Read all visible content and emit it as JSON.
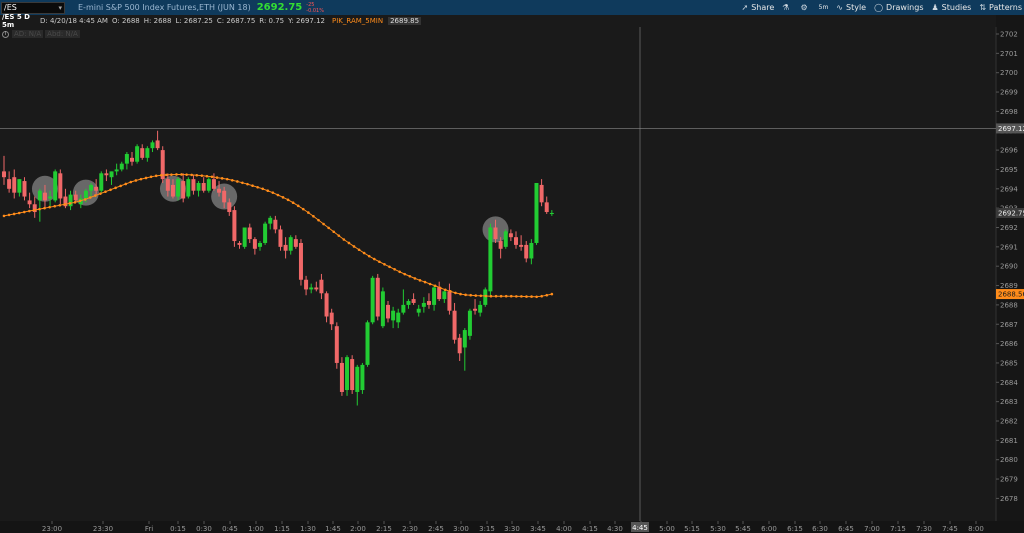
{
  "header": {
    "symbol": "/ES",
    "instrument": "E-mini S&P 500 Index Futures,ETH (JUN 18)",
    "last": "2692.75",
    "change": "-25",
    "change_pct": "-0.01%"
  },
  "toolbar": {
    "share": "Share",
    "style": "Style",
    "drawings": "Drawings",
    "studies": "Studies",
    "patterns": "Patterns",
    "timeframe": "5m"
  },
  "infobar": {
    "symbol": "/ES 5 D 5m",
    "date": "D: 4/20/18 4:45 AM",
    "open": "O: 2688",
    "high": "H: 2688",
    "low": "L: 2687.25",
    "close": "C: 2687.75",
    "range": "R: 0.75",
    "y": "Y: 2697.12",
    "study_name": "PIK_RAM_5MIN",
    "study_value": "2689.85"
  },
  "volume_label": {
    "ad": "AD: N/A",
    "abd": "Abd: N/A"
  },
  "colors": {
    "background": "#1a1a1a",
    "up": "#22cc33",
    "down": "#f06868",
    "ma": "#ff8c1a",
    "crosshair": "#888888",
    "highlight": "#aaaaaa"
  },
  "chart_data": {
    "type": "candlestick",
    "title": "",
    "x_labels": [
      "23:00",
      "23:30",
      "Fri",
      "0:15",
      "0:30",
      "0:45",
      "1:00",
      "1:15",
      "1:30",
      "1:45",
      "2:00",
      "2:15",
      "2:30",
      "2:45",
      "3:00",
      "3:15",
      "3:30",
      "3:45",
      "4:00",
      "4:15",
      "4:30",
      "4:45",
      "5:00",
      "5:15",
      "5:30",
      "5:45",
      "6:00",
      "6:15",
      "6:30",
      "6:45",
      "7:00",
      "7:15",
      "7:30",
      "7:45",
      "8:00"
    ],
    "y_ticks": [
      2678,
      2679,
      2680,
      2681,
      2682,
      2683,
      2684,
      2685,
      2686,
      2687,
      2688,
      2689,
      2690,
      2691,
      2692,
      2693,
      2694,
      2695,
      2696,
      2697,
      2698,
      2699,
      2700,
      2701,
      2702
    ],
    "ylim": [
      2677.8,
      2702.6
    ],
    "last_price_label": "2692.75",
    "ma_last_label": "2688.56",
    "crosshair_price_label": "2697.12",
    "crosshair_time_label": "4:45",
    "candles": [
      {
        "o": 2694.9,
        "h": 2695.7,
        "l": 2694.2,
        "c": 2694.6
      },
      {
        "o": 2694.5,
        "h": 2694.9,
        "l": 2693.8,
        "c": 2694.0
      },
      {
        "o": 2694.6,
        "h": 2695.0,
        "l": 2693.5,
        "c": 2693.8
      },
      {
        "o": 2693.8,
        "h": 2694.5,
        "l": 2693.6,
        "c": 2694.5
      },
      {
        "o": 2694.4,
        "h": 2694.6,
        "l": 2693.4,
        "c": 2693.6
      },
      {
        "o": 2693.4,
        "h": 2693.8,
        "l": 2693.0,
        "c": 2693.2
      },
      {
        "o": 2693.2,
        "h": 2693.6,
        "l": 2692.5,
        "c": 2692.8
      },
      {
        "o": 2693.4,
        "h": 2694.0,
        "l": 2692.3,
        "c": 2693.9
      },
      {
        "o": 2693.8,
        "h": 2694.2,
        "l": 2693.0,
        "c": 2693.4
      },
      {
        "o": 2693.5,
        "h": 2693.9,
        "l": 2693.1,
        "c": 2693.6
      },
      {
        "o": 2693.4,
        "h": 2695.0,
        "l": 2693.3,
        "c": 2694.9
      },
      {
        "o": 2694.8,
        "h": 2695.0,
        "l": 2693.2,
        "c": 2693.5
      },
      {
        "o": 2693.6,
        "h": 2694.0,
        "l": 2693.0,
        "c": 2693.1
      },
      {
        "o": 2693.1,
        "h": 2693.9,
        "l": 2692.9,
        "c": 2693.7
      },
      {
        "o": 2693.7,
        "h": 2693.9,
        "l": 2693.3,
        "c": 2693.4
      },
      {
        "o": 2693.2,
        "h": 2693.7,
        "l": 2693.0,
        "c": 2693.5
      },
      {
        "o": 2693.5,
        "h": 2694.0,
        "l": 2693.3,
        "c": 2693.9
      },
      {
        "o": 2693.9,
        "h": 2694.3,
        "l": 2693.6,
        "c": 2694.2
      },
      {
        "o": 2694.1,
        "h": 2694.5,
        "l": 2693.7,
        "c": 2693.9
      },
      {
        "o": 2693.9,
        "h": 2694.9,
        "l": 2693.8,
        "c": 2694.8
      },
      {
        "o": 2694.8,
        "h": 2695.0,
        "l": 2694.4,
        "c": 2694.7
      },
      {
        "o": 2694.6,
        "h": 2694.9,
        "l": 2694.2,
        "c": 2694.9
      },
      {
        "o": 2694.9,
        "h": 2695.3,
        "l": 2694.7,
        "c": 2695.0
      },
      {
        "o": 2695.0,
        "h": 2695.4,
        "l": 2694.9,
        "c": 2695.3
      },
      {
        "o": 2695.3,
        "h": 2695.9,
        "l": 2695.0,
        "c": 2695.8
      },
      {
        "o": 2695.6,
        "h": 2695.9,
        "l": 2695.2,
        "c": 2695.4
      },
      {
        "o": 2695.4,
        "h": 2696.3,
        "l": 2695.3,
        "c": 2696.2
      },
      {
        "o": 2696.1,
        "h": 2696.3,
        "l": 2695.5,
        "c": 2695.6
      },
      {
        "o": 2695.6,
        "h": 2696.2,
        "l": 2695.4,
        "c": 2696.1
      },
      {
        "o": 2696.1,
        "h": 2696.5,
        "l": 2695.9,
        "c": 2696.4
      },
      {
        "o": 2696.5,
        "h": 2697.0,
        "l": 2696.0,
        "c": 2696.1
      },
      {
        "o": 2696.0,
        "h": 2696.2,
        "l": 2694.3,
        "c": 2694.5
      },
      {
        "o": 2694.5,
        "h": 2694.8,
        "l": 2693.6,
        "c": 2693.9
      },
      {
        "o": 2694.2,
        "h": 2694.5,
        "l": 2693.5,
        "c": 2693.6
      },
      {
        "o": 2693.6,
        "h": 2694.6,
        "l": 2693.4,
        "c": 2694.5
      },
      {
        "o": 2694.4,
        "h": 2694.8,
        "l": 2693.3,
        "c": 2693.5
      },
      {
        "o": 2693.6,
        "h": 2694.6,
        "l": 2693.5,
        "c": 2694.5
      },
      {
        "o": 2694.5,
        "h": 2694.7,
        "l": 2693.7,
        "c": 2693.9
      },
      {
        "o": 2693.9,
        "h": 2694.4,
        "l": 2693.6,
        "c": 2694.3
      },
      {
        "o": 2694.3,
        "h": 2694.6,
        "l": 2693.8,
        "c": 2693.9
      },
      {
        "o": 2693.9,
        "h": 2694.6,
        "l": 2693.8,
        "c": 2694.5
      },
      {
        "o": 2694.5,
        "h": 2694.8,
        "l": 2693.9,
        "c": 2694.0
      },
      {
        "o": 2694.0,
        "h": 2694.4,
        "l": 2693.6,
        "c": 2693.8
      },
      {
        "o": 2693.9,
        "h": 2694.1,
        "l": 2693.0,
        "c": 2693.3
      },
      {
        "o": 2693.3,
        "h": 2693.5,
        "l": 2692.6,
        "c": 2692.8
      },
      {
        "o": 2692.9,
        "h": 2693.1,
        "l": 2691.0,
        "c": 2691.3
      },
      {
        "o": 2691.2,
        "h": 2691.3,
        "l": 2690.9,
        "c": 2691.1
      },
      {
        "o": 2691.0,
        "h": 2692.0,
        "l": 2690.9,
        "c": 2692.0
      },
      {
        "o": 2692.0,
        "h": 2692.2,
        "l": 2691.2,
        "c": 2691.4
      },
      {
        "o": 2691.4,
        "h": 2691.5,
        "l": 2690.6,
        "c": 2690.9
      },
      {
        "o": 2691.0,
        "h": 2691.3,
        "l": 2690.8,
        "c": 2691.2
      },
      {
        "o": 2691.2,
        "h": 2692.3,
        "l": 2691.1,
        "c": 2692.2
      },
      {
        "o": 2692.2,
        "h": 2692.6,
        "l": 2691.9,
        "c": 2692.5
      },
      {
        "o": 2692.4,
        "h": 2692.6,
        "l": 2691.7,
        "c": 2691.9
      },
      {
        "o": 2691.9,
        "h": 2692.1,
        "l": 2690.8,
        "c": 2691.0
      },
      {
        "o": 2691.1,
        "h": 2691.5,
        "l": 2690.4,
        "c": 2690.8
      },
      {
        "o": 2690.8,
        "h": 2691.6,
        "l": 2690.6,
        "c": 2691.5
      },
      {
        "o": 2691.4,
        "h": 2691.6,
        "l": 2690.9,
        "c": 2691.0
      },
      {
        "o": 2691.2,
        "h": 2691.4,
        "l": 2689.0,
        "c": 2689.3
      },
      {
        "o": 2689.3,
        "h": 2689.5,
        "l": 2688.5,
        "c": 2688.8
      },
      {
        "o": 2688.8,
        "h": 2689.1,
        "l": 2688.6,
        "c": 2688.9
      },
      {
        "o": 2688.9,
        "h": 2689.2,
        "l": 2688.7,
        "c": 2688.8
      },
      {
        "o": 2689.3,
        "h": 2689.6,
        "l": 2688.3,
        "c": 2688.6
      },
      {
        "o": 2688.6,
        "h": 2688.7,
        "l": 2687.1,
        "c": 2687.4
      },
      {
        "o": 2687.6,
        "h": 2687.8,
        "l": 2686.7,
        "c": 2687.0
      },
      {
        "o": 2686.9,
        "h": 2687.1,
        "l": 2684.7,
        "c": 2685.0
      },
      {
        "o": 2685.0,
        "h": 2685.3,
        "l": 2683.3,
        "c": 2683.5
      },
      {
        "o": 2683.6,
        "h": 2685.4,
        "l": 2683.3,
        "c": 2685.3
      },
      {
        "o": 2685.2,
        "h": 2685.4,
        "l": 2683.4,
        "c": 2683.6
      },
      {
        "o": 2683.5,
        "h": 2684.9,
        "l": 2682.8,
        "c": 2684.8
      },
      {
        "o": 2683.6,
        "h": 2685.0,
        "l": 2683.4,
        "c": 2684.9
      },
      {
        "o": 2684.9,
        "h": 2687.2,
        "l": 2684.8,
        "c": 2687.1
      },
      {
        "o": 2687.1,
        "h": 2689.5,
        "l": 2687.0,
        "c": 2689.4
      },
      {
        "o": 2689.4,
        "h": 2689.6,
        "l": 2687.2,
        "c": 2687.4
      },
      {
        "o": 2686.9,
        "h": 2688.9,
        "l": 2686.8,
        "c": 2688.7
      },
      {
        "o": 2688.0,
        "h": 2688.2,
        "l": 2687.1,
        "c": 2687.3
      },
      {
        "o": 2687.2,
        "h": 2687.9,
        "l": 2686.8,
        "c": 2687.7
      },
      {
        "o": 2687.1,
        "h": 2687.8,
        "l": 2686.8,
        "c": 2687.6
      },
      {
        "o": 2687.6,
        "h": 2688.8,
        "l": 2687.5,
        "c": 2688.0
      },
      {
        "o": 2688.0,
        "h": 2688.3,
        "l": 2687.8,
        "c": 2688.2
      },
      {
        "o": 2688.3,
        "h": 2688.6,
        "l": 2688.0,
        "c": 2688.1
      },
      {
        "o": 2687.6,
        "h": 2688.0,
        "l": 2687.4,
        "c": 2687.8
      },
      {
        "o": 2687.9,
        "h": 2688.4,
        "l": 2687.6,
        "c": 2688.1
      },
      {
        "o": 2688.2,
        "h": 2688.6,
        "l": 2687.8,
        "c": 2688.0
      },
      {
        "o": 2688.0,
        "h": 2689.0,
        "l": 2687.7,
        "c": 2688.9
      },
      {
        "o": 2688.9,
        "h": 2689.2,
        "l": 2688.2,
        "c": 2688.3
      },
      {
        "o": 2688.3,
        "h": 2688.8,
        "l": 2688.1,
        "c": 2688.7
      },
      {
        "o": 2688.7,
        "h": 2689.1,
        "l": 2687.5,
        "c": 2687.7
      },
      {
        "o": 2687.7,
        "h": 2688.1,
        "l": 2686.0,
        "c": 2686.2
      },
      {
        "o": 2686.3,
        "h": 2686.5,
        "l": 2685.1,
        "c": 2685.5
      },
      {
        "o": 2685.8,
        "h": 2686.8,
        "l": 2684.6,
        "c": 2686.7
      },
      {
        "o": 2686.4,
        "h": 2687.8,
        "l": 2686.2,
        "c": 2687.7
      },
      {
        "o": 2687.8,
        "h": 2688.3,
        "l": 2687.5,
        "c": 2687.7
      },
      {
        "o": 2687.6,
        "h": 2688.2,
        "l": 2687.4,
        "c": 2688.0
      },
      {
        "o": 2688.0,
        "h": 2688.9,
        "l": 2687.9,
        "c": 2688.8
      },
      {
        "o": 2688.7,
        "h": 2692.2,
        "l": 2688.5,
        "c": 2692.0
      },
      {
        "o": 2692.0,
        "h": 2692.4,
        "l": 2691.2,
        "c": 2691.4
      },
      {
        "o": 2691.3,
        "h": 2691.5,
        "l": 2690.4,
        "c": 2690.9
      },
      {
        "o": 2691.0,
        "h": 2691.9,
        "l": 2690.9,
        "c": 2691.8
      },
      {
        "o": 2691.7,
        "h": 2691.9,
        "l": 2691.3,
        "c": 2691.5
      },
      {
        "o": 2691.5,
        "h": 2691.8,
        "l": 2690.9,
        "c": 2691.1
      },
      {
        "o": 2691.1,
        "h": 2691.6,
        "l": 2690.8,
        "c": 2691.0
      },
      {
        "o": 2691.1,
        "h": 2691.3,
        "l": 2690.2,
        "c": 2690.4
      },
      {
        "o": 2690.4,
        "h": 2691.4,
        "l": 2690.1,
        "c": 2691.2
      },
      {
        "o": 2691.2,
        "h": 2694.3,
        "l": 2691.1,
        "c": 2694.3
      },
      {
        "o": 2694.2,
        "h": 2694.5,
        "l": 2693.1,
        "c": 2693.3
      },
      {
        "o": 2693.3,
        "h": 2693.6,
        "l": 2692.7,
        "c": 2692.8
      },
      {
        "o": 2692.7,
        "h": 2692.9,
        "l": 2692.6,
        "c": 2692.75
      }
    ],
    "moving_average": [
      2692.6,
      2692.65,
      2692.7,
      2692.75,
      2692.8,
      2692.85,
      2692.9,
      2692.95,
      2693.0,
      2693.05,
      2693.1,
      2693.15,
      2693.2,
      2693.25,
      2693.3,
      2693.38,
      2693.45,
      2693.55,
      2693.65,
      2693.75,
      2693.85,
      2693.95,
      2694.05,
      2694.15,
      2694.25,
      2694.35,
      2694.43,
      2694.5,
      2694.56,
      2694.62,
      2694.67,
      2694.7,
      2694.72,
      2694.73,
      2694.74,
      2694.74,
      2694.73,
      2694.72,
      2694.7,
      2694.68,
      2694.65,
      2694.62,
      2694.58,
      2694.54,
      2694.5,
      2694.44,
      2694.38,
      2694.31,
      2694.24,
      2694.16,
      2694.08,
      2694.0,
      2693.9,
      2693.8,
      2693.68,
      2693.56,
      2693.43,
      2693.28,
      2693.12,
      2692.95,
      2692.77,
      2692.58,
      2692.38,
      2692.18,
      2691.98,
      2691.78,
      2691.58,
      2691.38,
      2691.2,
      2691.02,
      2690.85,
      2690.68,
      2690.52,
      2690.37,
      2690.23,
      2690.1,
      2689.97,
      2689.84,
      2689.71,
      2689.59,
      2689.48,
      2689.37,
      2689.27,
      2689.18,
      2689.08,
      2688.99,
      2688.88,
      2688.78,
      2688.7,
      2688.62,
      2688.56,
      2688.52,
      2688.5,
      2688.48,
      2688.47,
      2688.46,
      2688.45,
      2688.45,
      2688.45,
      2688.45,
      2688.45,
      2688.44,
      2688.44,
      2688.43,
      2688.43,
      2688.42,
      2688.45,
      2688.5,
      2688.56
    ],
    "highlight_circles": [
      {
        "index": 8,
        "price": 2694.0
      },
      {
        "index": 16,
        "price": 2693.8
      },
      {
        "index": 33,
        "price": 2694.0
      },
      {
        "index": 43,
        "price": 2693.6
      },
      {
        "index": 96,
        "price": 2691.9
      }
    ]
  }
}
